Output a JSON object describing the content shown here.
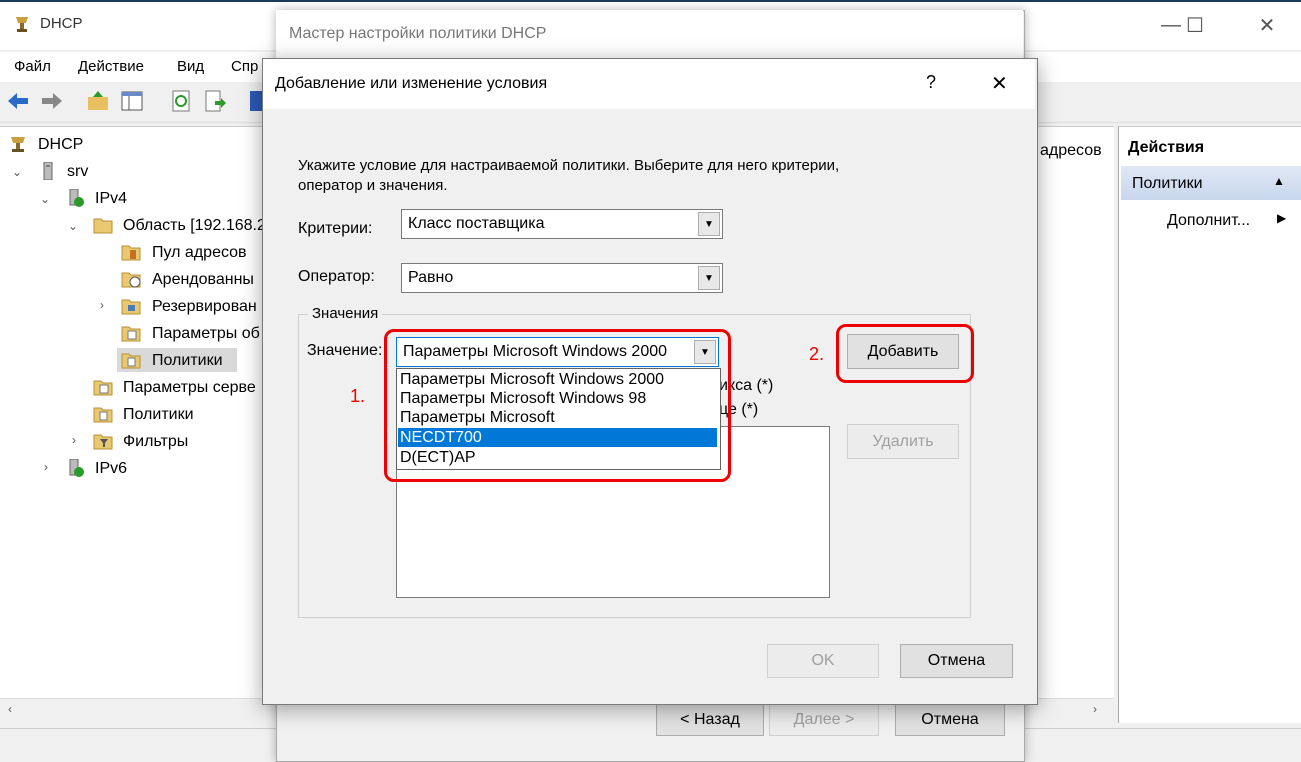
{
  "main_window": {
    "title": "DHCP",
    "caption": {
      "minimize": "—",
      "maximize": "☐",
      "close": "✕"
    },
    "menu": [
      "Файл",
      "Действие",
      "Вид",
      "Спр"
    ],
    "tree": [
      {
        "label": "DHCP",
        "icon": "dhcp-icon"
      },
      {
        "label": "srv",
        "icon": "server-icon"
      },
      {
        "label": "IPv4",
        "icon": "ipv4-icon"
      },
      {
        "label": "Область [192.168.2",
        "icon": "folder-icon"
      },
      {
        "label": "Пул адресов",
        "icon": "address-pool-icon"
      },
      {
        "label": "Арендованны",
        "icon": "leases-icon"
      },
      {
        "label": "Резервирован",
        "icon": "reservations-icon"
      },
      {
        "label": "Параметры об",
        "icon": "scope-options-icon"
      },
      {
        "label": "Политики",
        "icon": "policies-icon"
      },
      {
        "label": "Параметры серве",
        "icon": "server-options-icon"
      },
      {
        "label": "Политики",
        "icon": "policies-icon"
      },
      {
        "label": "Фильтры",
        "icon": "filters-icon"
      },
      {
        "label": "IPv6",
        "icon": "ipv6-icon"
      }
    ],
    "middle_fragment": "адресов",
    "actions": {
      "header": "Действия",
      "section": "Политики",
      "item": "Дополнит..."
    }
  },
  "wizard": {
    "title": "Мастер настройки политики DHCP",
    "back": "< Назад",
    "next": "Далее >",
    "cancel": "Отмена"
  },
  "dialog": {
    "title": "Добавление или изменение условия",
    "help": "?",
    "close": "✕",
    "instruction_line1": "Укажите условие для настраиваемой политики. Выберите для него критерии,",
    "instruction_line2": "оператор и значения.",
    "criteria_label": "Критерии:",
    "criteria_value": "Класс поставщика",
    "operator_label": "Оператор:",
    "operator_value": "Равно",
    "values_group": "Значения",
    "value_label": "Значение:",
    "value_selected": "Параметры Microsoft Windows 2000",
    "dropdown_options": [
      "Параметры Microsoft Windows 2000",
      "Параметры Microsoft Windows 98",
      "Параметры Microsoft",
      "NECDT700",
      "D(ECT)AP"
    ],
    "dropdown_highlighted_index": 3,
    "hidden_text_1": "икса  (*)",
    "hidden_text_2": "це (*)",
    "add_button": "Добавить",
    "remove_button": "Удалить",
    "ok_button": "OK",
    "cancel_button": "Отмена"
  },
  "annotations": {
    "step1": "1.",
    "step2": "2.",
    "color": "#e00000"
  }
}
